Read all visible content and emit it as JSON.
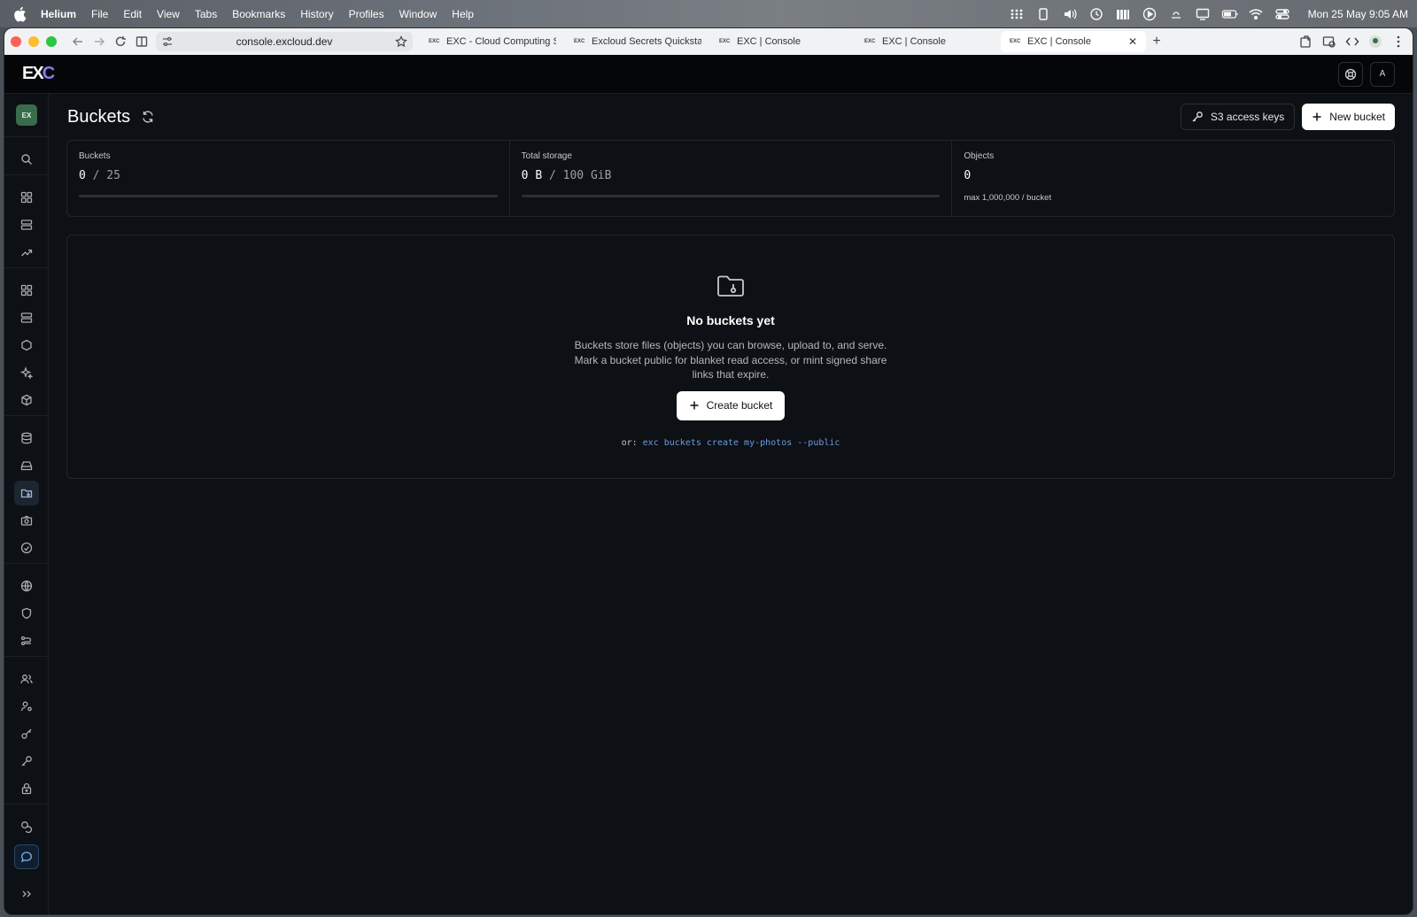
{
  "menubar": {
    "app_name": "Helium",
    "items": [
      "File",
      "Edit",
      "View",
      "Tabs",
      "Bookmarks",
      "History",
      "Profiles",
      "Window",
      "Help"
    ],
    "clock": "Mon 25 May  9:05 AM",
    "status_icons": [
      "grid-icon",
      "clipboard-icon",
      "volume-icon",
      "clock-icon",
      "cellular-icon",
      "play-icon",
      "weather-icon",
      "display-icon",
      "battery-icon",
      "wifi-icon",
      "control-center-icon"
    ]
  },
  "browser": {
    "url": "console.excloud.dev",
    "tabs": [
      {
        "favicon": "EXC",
        "title": "EXC - Cloud Computing Serv",
        "active": false
      },
      {
        "favicon": "EXC",
        "title": "Excloud Secrets Quickstart",
        "active": false
      },
      {
        "favicon": "EXC",
        "title": "EXC | Console",
        "active": false
      },
      {
        "favicon": "EXC",
        "title": "EXC | Console",
        "active": false
      },
      {
        "favicon": "EXC",
        "title": "EXC | Console",
        "active": true
      }
    ],
    "new_tab": "+",
    "close_tab": "✕"
  },
  "app": {
    "logo_ex": "EX",
    "logo_c": "C",
    "avatar_initial": "A",
    "org_badge": "EX"
  },
  "page": {
    "title": "Buckets",
    "s3_keys_label": "S3 access keys",
    "new_bucket_label": "New bucket"
  },
  "stats": {
    "buckets": {
      "label": "Buckets",
      "value": "0",
      "limit": "/ 25",
      "fill": 0
    },
    "storage": {
      "label": "Total storage",
      "value": "0 B",
      "limit": "/ 100 GiB",
      "fill": 0
    },
    "objects": {
      "label": "Objects",
      "value": "0",
      "note": "max 1,000,000 / bucket"
    }
  },
  "empty_state": {
    "title": "No buckets yet",
    "description": "Buckets store files (objects) you can browse, upload to, and serve. Mark a bucket public for blanket read access, or mint signed share links that expire.",
    "create_label": "Create bucket",
    "cli_prefix": "or:",
    "cli_command": "exc buckets create my-photos --public"
  },
  "colors": {
    "accent": "#8a7cf0",
    "link": "#6b9de0",
    "background": "#0d1014",
    "header_bg": "#050608"
  }
}
